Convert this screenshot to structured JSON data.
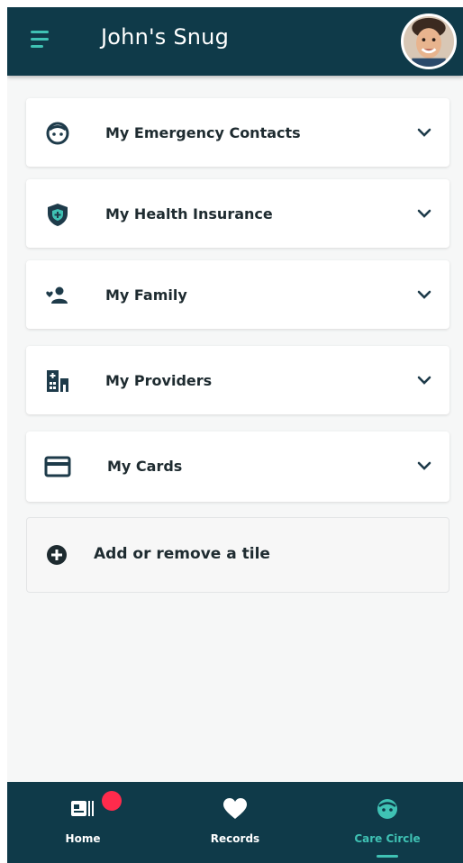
{
  "header": {
    "title": "John's Snug",
    "menu_icon": "hamburger-menu-icon",
    "avatar_icon": "user-avatar"
  },
  "tiles": [
    {
      "label": "My Emergency Contacts",
      "icon": "face-icon"
    },
    {
      "label": "My Health Insurance",
      "icon": "shield-icon"
    },
    {
      "label": "My Family",
      "icon": "family-icon"
    },
    {
      "label": "My Providers",
      "icon": "hospital-icon"
    },
    {
      "label": "My Cards",
      "icon": "credit-card-icon"
    }
  ],
  "add_tile": {
    "label": "Add or remove a tile",
    "icon": "plus-circle-icon"
  },
  "bottom_nav": {
    "items": [
      {
        "label": "Home",
        "icon": "id-card-icon",
        "active": false,
        "badge": true
      },
      {
        "label": "Records",
        "icon": "heart-icon",
        "active": false
      },
      {
        "label": "Care Circle",
        "icon": "face-icon",
        "active": true
      }
    ]
  },
  "colors": {
    "header_bg": "#0f3a49",
    "accent": "#3fc2b4",
    "badge": "#ff2b4c",
    "text_dark": "#1e2b30"
  }
}
